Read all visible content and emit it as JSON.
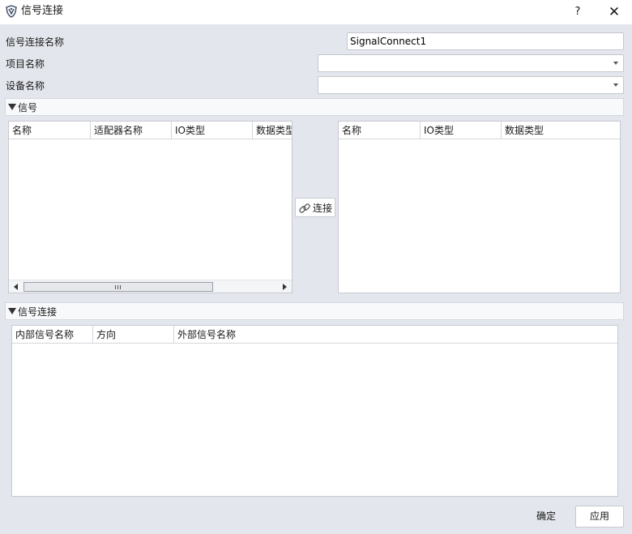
{
  "window": {
    "title": "信号连接",
    "help_label": "?",
    "close_label": "✕",
    "icon": "app-logo-icon"
  },
  "form": {
    "connection_name_label": "信号连接名称",
    "connection_name_value": "SignalConnect1",
    "project_name_label": "项目名称",
    "project_name_value": "",
    "device_name_label": "设备名称",
    "device_name_value": ""
  },
  "signal_section": {
    "title": "信号",
    "left_table": {
      "columns": [
        "名称",
        "适配器名称",
        "IO类型",
        "数据类型"
      ],
      "rows": []
    },
    "right_table": {
      "columns": [
        "名称",
        "IO类型",
        "数据类型"
      ],
      "rows": []
    },
    "connect_button": {
      "label": "连接",
      "icon": "link-icon"
    }
  },
  "connection_section": {
    "title": "信号连接",
    "table": {
      "columns": [
        "内部信号名称",
        "方向",
        "外部信号名称"
      ],
      "rows": []
    }
  },
  "footer": {
    "ok_label": "确定",
    "apply_label": "应用"
  },
  "colors": {
    "background": "#e3e6ec",
    "panel": "#ffffff",
    "border": "#c6cad0"
  }
}
